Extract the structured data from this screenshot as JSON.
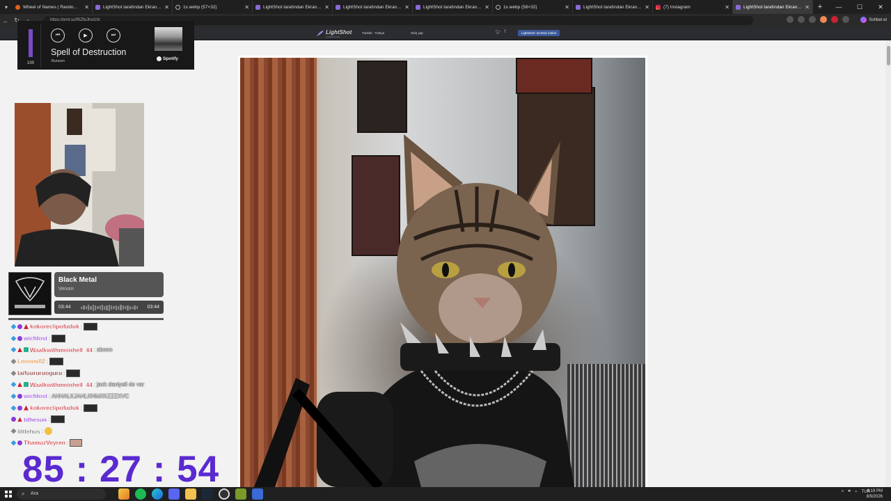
{
  "browser": {
    "tabs": [
      {
        "title": "Wheel of Names | Random name picker",
        "icon": "wheel-icon",
        "active": false
      },
      {
        "title": "LightShot tarafından Ekran Görüntüsü",
        "icon": "lightshot-icon",
        "active": false
      },
      {
        "title": "1x.webp (57×32)",
        "icon": "globe-icon",
        "active": false
      },
      {
        "title": "LightShot tarafından Ekran Görüntüsü",
        "icon": "lightshot-icon",
        "active": false
      },
      {
        "title": "LightShot tarafından Ekran Görüntüsü",
        "icon": "lightshot-icon",
        "active": false
      },
      {
        "title": "LightShot tarafından Ekran Görüntüsü",
        "icon": "lightshot-icon",
        "active": false
      },
      {
        "title": "1x.webp (58×32)",
        "icon": "globe-icon",
        "active": false
      },
      {
        "title": "LightShot tarafından Ekran Görüntüsü",
        "icon": "lightshot-icon",
        "active": false
      },
      {
        "title": "(7) Instagram",
        "icon": "instagram-icon",
        "active": false
      },
      {
        "title": "LightShot tarafından Ekran Görüntüsü",
        "icon": "lightshot-icon",
        "active": true
      }
    ],
    "new_tab": "+",
    "url": "https://prnt.sc/RiZfpJhsj1Sr",
    "copilot_label": "Sohbet et"
  },
  "lightshot": {
    "logo": "LightShot",
    "logo_sub": "screenshot tool",
    "language": "Turkish · Türkçe",
    "login": "Giriş yap",
    "download": "Lightshot'ı ücretsiz indirin"
  },
  "spotify": {
    "volume": 100,
    "volume_label": "100",
    "title": "Spell of Destruction",
    "artist": "Burzum",
    "brand": "Spotify"
  },
  "now_playing": {
    "title": "Black Metal",
    "artist": "Venom",
    "current": "03:44",
    "total": "03:44"
  },
  "chat": [
    {
      "user": "kokoreclipofuduk",
      "color": "#c8202a",
      "badges": [
        "blue",
        "purple",
        "red"
      ],
      "text": "",
      "emote": "dark"
    },
    {
      "user": "wichlost",
      "color": "#8a2ad8",
      "badges": [
        "blue",
        "purple"
      ],
      "text": "",
      "emote": "dark"
    },
    {
      "user": "Waalkwithmeinhell_44",
      "color": "#c8202a",
      "badges": [
        "blue",
        "red",
        "green"
      ],
      "text": "abooo",
      "emote": ""
    },
    {
      "user": "Leonov02",
      "color": "#e07a20",
      "badges": [
        "grey"
      ],
      "text": "",
      "emote": "dark"
    },
    {
      "user": "taifuururuoguru",
      "color": "#7a1010",
      "badges": [
        "grey"
      ],
      "text": "",
      "emote": "dark"
    },
    {
      "user": "Waalkwithmeinhell_44",
      "color": "#c8202a",
      "badges": [
        "blue",
        "red",
        "green"
      ],
      "text": "jack daniyeli de var",
      "emote": ""
    },
    {
      "user": "wichlost",
      "color": "#8a2ad8",
      "badges": [
        "blue",
        "purple"
      ],
      "text": "AHHALKJAHLKNMXKZZZXVC",
      "emote": ""
    },
    {
      "user": "kokoreclipofuduk",
      "color": "#c8202a",
      "badges": [
        "blue",
        "purple",
        "red"
      ],
      "text": "",
      "emote": "dark"
    },
    {
      "user": "tdhesun",
      "color": "#8a2ad8",
      "badges": [
        "purple",
        "red"
      ],
      "text": "",
      "emote": "dark"
    },
    {
      "user": "littlehus",
      "color": "#666666",
      "badges": [
        "grey"
      ],
      "text": "",
      "emote": "smile"
    },
    {
      "user": "ThamuzVeyren",
      "color": "#c8202a",
      "badges": [
        "blue",
        "purple"
      ],
      "text": "",
      "emote": "face"
    }
  ],
  "timer": "85 : 27 : 54",
  "taskbar": {
    "search_placeholder": "Ara",
    "language": "TUR",
    "time": "6:19 PM",
    "date": "8/9/2026"
  }
}
